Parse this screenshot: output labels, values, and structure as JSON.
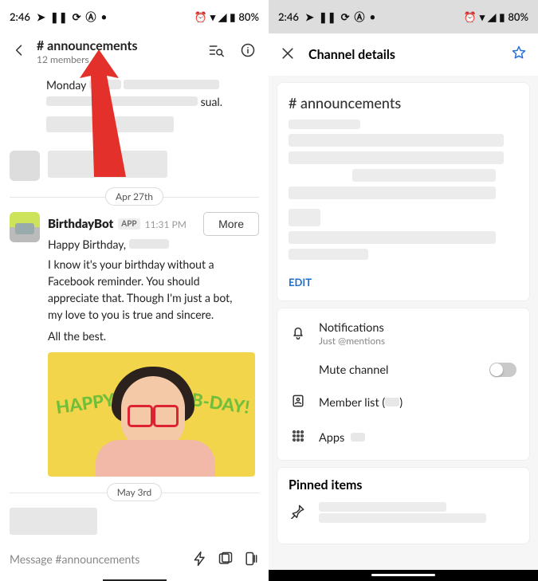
{
  "statusbar": {
    "time": "2:46",
    "battery": "80%"
  },
  "left": {
    "channel_hash": "#",
    "channel_name": "announcements",
    "members": "12 members",
    "frag_line1": "Monday",
    "frag_line2": "sual.",
    "date1": "Apr 27th",
    "sender": "BirthdayBot",
    "app_badge": "APP",
    "timestamp": "11:31 PM",
    "more": "More",
    "greeting": "Happy Birthday,",
    "body": "I know it's your birthday without a Facebook reminder. You should appreciate that. Though I'm just a bot, my love to you is true and sincere.",
    "signoff": "All the best.",
    "img_happy": "HAPPY",
    "img_bday": "B-DAY!",
    "date2": "May 3rd",
    "composer_placeholder": "Message #announcements"
  },
  "right": {
    "title": "Channel details",
    "chan_prefix": "#",
    "chan_name": "announcements",
    "edit": "EDIT",
    "notifications": "Notifications",
    "notif_sub": "Just @mentions",
    "mute": "Mute channel",
    "member_list": "Member list (",
    "member_list_close": ")",
    "apps": "Apps",
    "pinned": "Pinned items"
  }
}
